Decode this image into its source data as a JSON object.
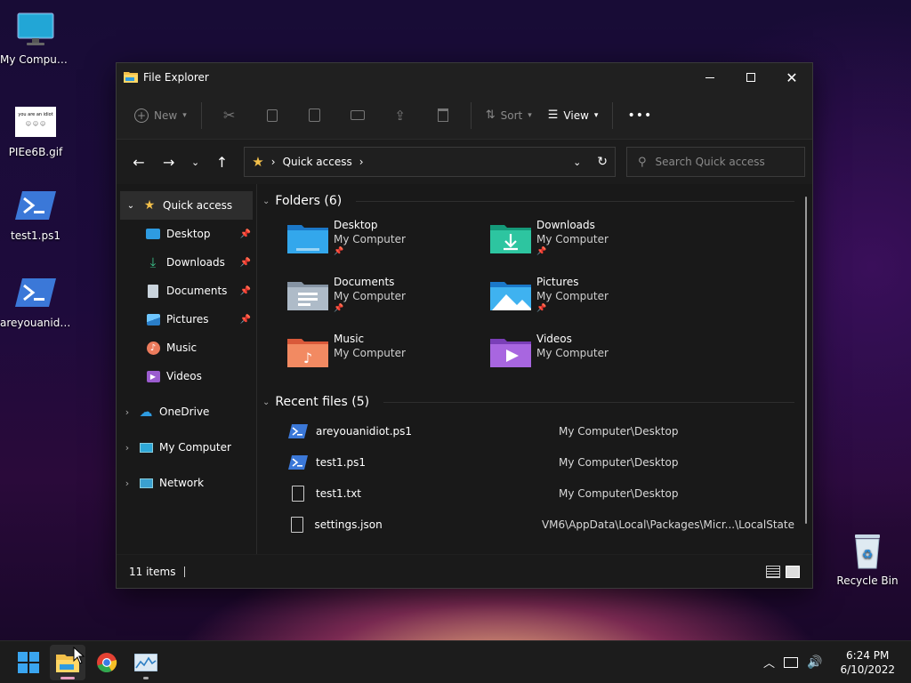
{
  "desktop": {
    "icons": [
      {
        "label": "My Computer"
      },
      {
        "label": "PIEe6B.gif"
      },
      {
        "label": "test1.ps1"
      },
      {
        "label": "areyouanidi..."
      },
      {
        "label": "Recycle Bin"
      }
    ],
    "gif_thumb_text": "you are an idiot"
  },
  "window": {
    "title": "File Explorer",
    "toolbar": {
      "new_label": "New",
      "sort_label": "Sort",
      "view_label": "View",
      "more_label": "•••"
    },
    "address": {
      "location": "Quick access",
      "search_placeholder": "Search Quick access"
    },
    "sidebar": {
      "quick_access": "Quick access",
      "pinned": [
        {
          "label": "Desktop"
        },
        {
          "label": "Downloads"
        },
        {
          "label": "Documents"
        },
        {
          "label": "Pictures"
        },
        {
          "label": "Music"
        },
        {
          "label": "Videos"
        }
      ],
      "roots": [
        {
          "label": "OneDrive"
        },
        {
          "label": "My Computer"
        },
        {
          "label": "Network"
        }
      ]
    },
    "folders_header": "Folders (6)",
    "folders": [
      {
        "name": "Desktop",
        "location": "My Computer"
      },
      {
        "name": "Downloads",
        "location": "My Computer"
      },
      {
        "name": "Documents",
        "location": "My Computer"
      },
      {
        "name": "Pictures",
        "location": "My Computer"
      },
      {
        "name": "Music",
        "location": "My Computer"
      },
      {
        "name": "Videos",
        "location": "My Computer"
      }
    ],
    "recent_header": "Recent files (5)",
    "recent": [
      {
        "name": "areyouanidiot.ps1",
        "location": "My Computer\\Desktop"
      },
      {
        "name": "test1.ps1",
        "location": "My Computer\\Desktop"
      },
      {
        "name": "test1.txt",
        "location": "My Computer\\Desktop"
      },
      {
        "name": "settings.json",
        "location": "VM6\\AppData\\Local\\Packages\\Micr...\\LocalState"
      }
    ],
    "status": {
      "items": "11 items"
    }
  },
  "taskbar": {
    "time": "6:24 PM",
    "date": "6/10/2022"
  },
  "colors": {
    "accent": "#0a84d8",
    "folder_yellow": "#f3c04a",
    "taskbar_indicator": "#e99fc0"
  }
}
